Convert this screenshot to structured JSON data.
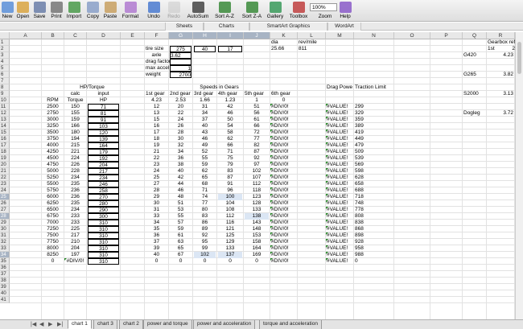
{
  "toolbar": [
    {
      "label": "New",
      "icon": "new-document-icon",
      "color": "#5b8fd8",
      "enabled": true
    },
    {
      "label": "Open",
      "icon": "open-folder-icon",
      "color": "#d9a441",
      "enabled": true
    },
    {
      "label": "Save",
      "icon": "save-icon",
      "color": "#6a7ea8",
      "enabled": true
    },
    {
      "label": "Print",
      "icon": "print-icon",
      "color": "#777",
      "enabled": true
    },
    {
      "label": "Import",
      "icon": "import-icon",
      "color": "#4a9a4a",
      "enabled": true
    },
    {
      "label": "Copy",
      "icon": "copy-icon",
      "color": "#8aa0c8",
      "enabled": true
    },
    {
      "label": "Paste",
      "icon": "paste-icon",
      "color": "#c8a060",
      "enabled": true
    },
    {
      "label": "Format",
      "icon": "format-brush-icon",
      "color": "#b07ad0",
      "enabled": true
    },
    {
      "label": "Undo",
      "icon": "undo-icon",
      "color": "#4a7ad0",
      "enabled": true
    },
    {
      "label": "Redo",
      "icon": "redo-icon",
      "color": "#bbb",
      "enabled": false
    },
    {
      "label": "AutoSum",
      "icon": "autosum-icon",
      "color": "#444",
      "enabled": true
    },
    {
      "label": "Sort A-Z",
      "icon": "sort-ascending-icon",
      "color": "#3a8a3a",
      "enabled": true
    },
    {
      "label": "Sort Z-A",
      "icon": "sort-descending-icon",
      "color": "#3a8a3a",
      "enabled": true
    },
    {
      "label": "Gallery",
      "icon": "gallery-icon",
      "color": "#3a9a5a",
      "enabled": true
    },
    {
      "label": "Toolbox",
      "icon": "toolbox-icon",
      "color": "#c04040",
      "enabled": true
    },
    {
      "label": "Zoom",
      "icon": "zoom-icon",
      "color": "#888",
      "enabled": true
    },
    {
      "label": "Help",
      "icon": "help-icon",
      "color": "#8a5ac8",
      "enabled": true
    }
  ],
  "zoom_value": "100%",
  "ribbon_tabs": [
    "Sheets",
    "Charts",
    "SmartArt Graphics",
    "WordArt"
  ],
  "columns": [
    "A",
    "B",
    "C",
    "D",
    "E",
    "F",
    "G",
    "H",
    "I",
    "J",
    "K",
    "L",
    "M",
    "N",
    "O",
    "P",
    "Q",
    "R"
  ],
  "selected_columns": [
    "G",
    "H",
    "I",
    "J"
  ],
  "selected_rows": [
    25,
    28,
    34
  ],
  "rows": [
    "1",
    "2",
    "3",
    "4",
    "5",
    "6",
    "7",
    "8",
    "9",
    "10",
    "11",
    "12",
    "13",
    "14",
    "15",
    "16",
    "17",
    "18",
    "19",
    "20",
    "21",
    "22",
    "23",
    "24",
    "25",
    "26",
    "27",
    "28",
    "29",
    "30",
    "31",
    "32",
    "33",
    "34",
    "35",
    "36",
    "37",
    "38",
    "39",
    "40",
    "41"
  ],
  "inputs": {
    "tire_size_label": "tire size",
    "tire_size": [
      "275",
      "40",
      "17"
    ],
    "axle_label": "axle",
    "axle": "3.62",
    "drag_factor_label": "drag factor",
    "max_accel_label": "max accel",
    "max_accel": "1",
    "weight_label": "weight",
    "weight": "2700",
    "dia_label": "dia",
    "dia": "25.66",
    "revmile_label": "rev/mile",
    "revmile": "811"
  },
  "gearbox": {
    "header": "Gearbox refe",
    "first_label": "1st",
    "col2": "2",
    "items": [
      {
        "name": "G420",
        "ratio": "4.23"
      },
      {
        "name": "G265",
        "ratio": "3.82"
      },
      {
        "name": "S2000",
        "ratio": "3.13"
      },
      {
        "name": "Dogleg",
        "ratio": "3.72"
      }
    ]
  },
  "section_titles": {
    "hp_torque": "HP/Torque",
    "speeds": "Speeds in Gears",
    "drag": "Drag Powe",
    "traction": "Traction Limit"
  },
  "table_headers": {
    "calc": "calc",
    "input": "input",
    "rpm": "RPM",
    "torque": "Torque",
    "hp": "HP"
  },
  "gear_headers": [
    "1st gear",
    "2nd gear",
    "3rd gear",
    "4th gear",
    "5th gear",
    "6th gear"
  ],
  "gear_ratios": [
    "4.23",
    "2.53",
    "1.66",
    "1.23",
    "1",
    "0"
  ],
  "table_rows": [
    {
      "rpm": "2500",
      "torque": "150",
      "hp": "71",
      "g": [
        "12",
        "20",
        "31",
        "42",
        "51"
      ],
      "g6": "#DIV/0!",
      "drag": "#VALUE!",
      "trac": "299"
    },
    {
      "rpm": "2750",
      "torque": "155",
      "hp": "81",
      "g": [
        "13",
        "22",
        "34",
        "46",
        "56"
      ],
      "g6": "#DIV/0!",
      "drag": "#VALUE!",
      "trac": "329"
    },
    {
      "rpm": "3000",
      "torque": "159",
      "hp": "91",
      "g": [
        "15",
        "24",
        "37",
        "50",
        "61"
      ],
      "g6": "#DIV/0!",
      "drag": "#VALUE!",
      "trac": "359"
    },
    {
      "rpm": "3250",
      "torque": "166",
      "hp": "103",
      "g": [
        "16",
        "26",
        "40",
        "54",
        "66"
      ],
      "g6": "#DIV/0!",
      "drag": "#VALUE!",
      "trac": "389"
    },
    {
      "rpm": "3500",
      "torque": "180",
      "hp": "120",
      "g": [
        "17",
        "28",
        "43",
        "58",
        "72"
      ],
      "g6": "#DIV/0!",
      "drag": "#VALUE!",
      "trac": "419"
    },
    {
      "rpm": "3750",
      "torque": "194",
      "hp": "139",
      "g": [
        "18",
        "30",
        "46",
        "62",
        "77"
      ],
      "g6": "#DIV/0!",
      "drag": "#VALUE!",
      "trac": "449"
    },
    {
      "rpm": "4000",
      "torque": "215",
      "hp": "164",
      "g": [
        "19",
        "32",
        "49",
        "66",
        "82"
      ],
      "g6": "#DIV/0!",
      "drag": "#VALUE!",
      "trac": "479"
    },
    {
      "rpm": "4250",
      "torque": "221",
      "hp": "179",
      "g": [
        "21",
        "34",
        "52",
        "71",
        "87"
      ],
      "g6": "#DIV/0!",
      "drag": "#VALUE!",
      "trac": "509"
    },
    {
      "rpm": "4500",
      "torque": "224",
      "hp": "192",
      "g": [
        "22",
        "36",
        "55",
        "75",
        "92"
      ],
      "g6": "#DIV/0!",
      "drag": "#VALUE!",
      "trac": "539"
    },
    {
      "rpm": "4750",
      "torque": "226",
      "hp": "204",
      "g": [
        "23",
        "38",
        "59",
        "79",
        "97"
      ],
      "g6": "#DIV/0!",
      "drag": "#VALUE!",
      "trac": "569"
    },
    {
      "rpm": "5000",
      "torque": "228",
      "hp": "217",
      "g": [
        "24",
        "40",
        "62",
        "83",
        "102"
      ],
      "g6": "#DIV/0!",
      "drag": "#VALUE!",
      "trac": "598"
    },
    {
      "rpm": "5250",
      "torque": "234",
      "hp": "234",
      "g": [
        "25",
        "42",
        "65",
        "87",
        "107"
      ],
      "g6": "#DIV/0!",
      "drag": "#VALUE!",
      "trac": "628"
    },
    {
      "rpm": "5500",
      "torque": "235",
      "hp": "246",
      "g": [
        "27",
        "44",
        "68",
        "91",
        "112"
      ],
      "g6": "#DIV/0!",
      "drag": "#VALUE!",
      "trac": "658"
    },
    {
      "rpm": "5750",
      "torque": "236",
      "hp": "258",
      "g": [
        "28",
        "46",
        "71",
        "96",
        "118"
      ],
      "g6": "#DIV/0!",
      "drag": "#VALUE!",
      "trac": "688"
    },
    {
      "rpm": "6000",
      "torque": "236",
      "hp": "270",
      "g": [
        "29",
        "48",
        "74",
        "100",
        "123"
      ],
      "g6": "#DIV/0!",
      "drag": "#VALUE!",
      "trac": "718"
    },
    {
      "rpm": "6250",
      "torque": "235",
      "hp": "280",
      "g": [
        "30",
        "51",
        "77",
        "104",
        "128"
      ],
      "g6": "#DIV/0!",
      "drag": "#VALUE!",
      "trac": "748"
    },
    {
      "rpm": "6500",
      "torque": "234",
      "hp": "290",
      "g": [
        "31",
        "53",
        "80",
        "108",
        "133"
      ],
      "g6": "#DIV/0!",
      "drag": "#VALUE!",
      "trac": "778"
    },
    {
      "rpm": "6750",
      "torque": "233",
      "hp": "300",
      "g": [
        "33",
        "55",
        "83",
        "112",
        "138"
      ],
      "g6": "#DIV/0!",
      "drag": "#VALUE!",
      "trac": "808"
    },
    {
      "rpm": "7000",
      "torque": "233",
      "hp": "310",
      "g": [
        "34",
        "57",
        "86",
        "116",
        "143"
      ],
      "g6": "#DIV/0!",
      "drag": "#VALUE!",
      "trac": "838"
    },
    {
      "rpm": "7250",
      "torque": "225",
      "hp": "310",
      "g": [
        "35",
        "59",
        "89",
        "121",
        "148"
      ],
      "g6": "#DIV/0!",
      "drag": "#VALUE!",
      "trac": "868"
    },
    {
      "rpm": "7500",
      "torque": "217",
      "hp": "310",
      "g": [
        "36",
        "61",
        "92",
        "125",
        "153"
      ],
      "g6": "#DIV/0!",
      "drag": "#VALUE!",
      "trac": "898"
    },
    {
      "rpm": "7750",
      "torque": "210",
      "hp": "310",
      "g": [
        "37",
        "63",
        "95",
        "129",
        "158"
      ],
      "g6": "#DIV/0!",
      "drag": "#VALUE!",
      "trac": "928"
    },
    {
      "rpm": "8000",
      "torque": "204",
      "hp": "310",
      "g": [
        "39",
        "65",
        "99",
        "133",
        "164"
      ],
      "g6": "#DIV/0!",
      "drag": "#VALUE!",
      "trac": "958"
    },
    {
      "rpm": "8250",
      "torque": "197",
      "hp": "310",
      "g": [
        "40",
        "67",
        "102",
        "137",
        "169"
      ],
      "g6": "#DIV/0!",
      "drag": "#VALUE!",
      "trac": "988"
    },
    {
      "rpm": "0",
      "torque": "#DIV/0!",
      "hp": "310",
      "g": [
        "0",
        "0",
        "0",
        "0",
        "0"
      ],
      "g6": "#DIV/0!",
      "drag": "#VALUE!",
      "trac": "0"
    }
  ],
  "sheet_tabs": [
    {
      "label": "chart 1",
      "active": true
    },
    {
      "label": "chart 3",
      "active": false
    },
    {
      "label": "chart 2",
      "active": false
    },
    {
      "label": "power and torque",
      "active": false
    },
    {
      "label": "power and acceleration",
      "active": false
    },
    {
      "label": "torque and acceleration",
      "active": false
    }
  ],
  "colors": {
    "selection_header": "#a8b4c4",
    "highlight_cell": "#dbe6f4",
    "error_marker": "#2a8a2a"
  }
}
